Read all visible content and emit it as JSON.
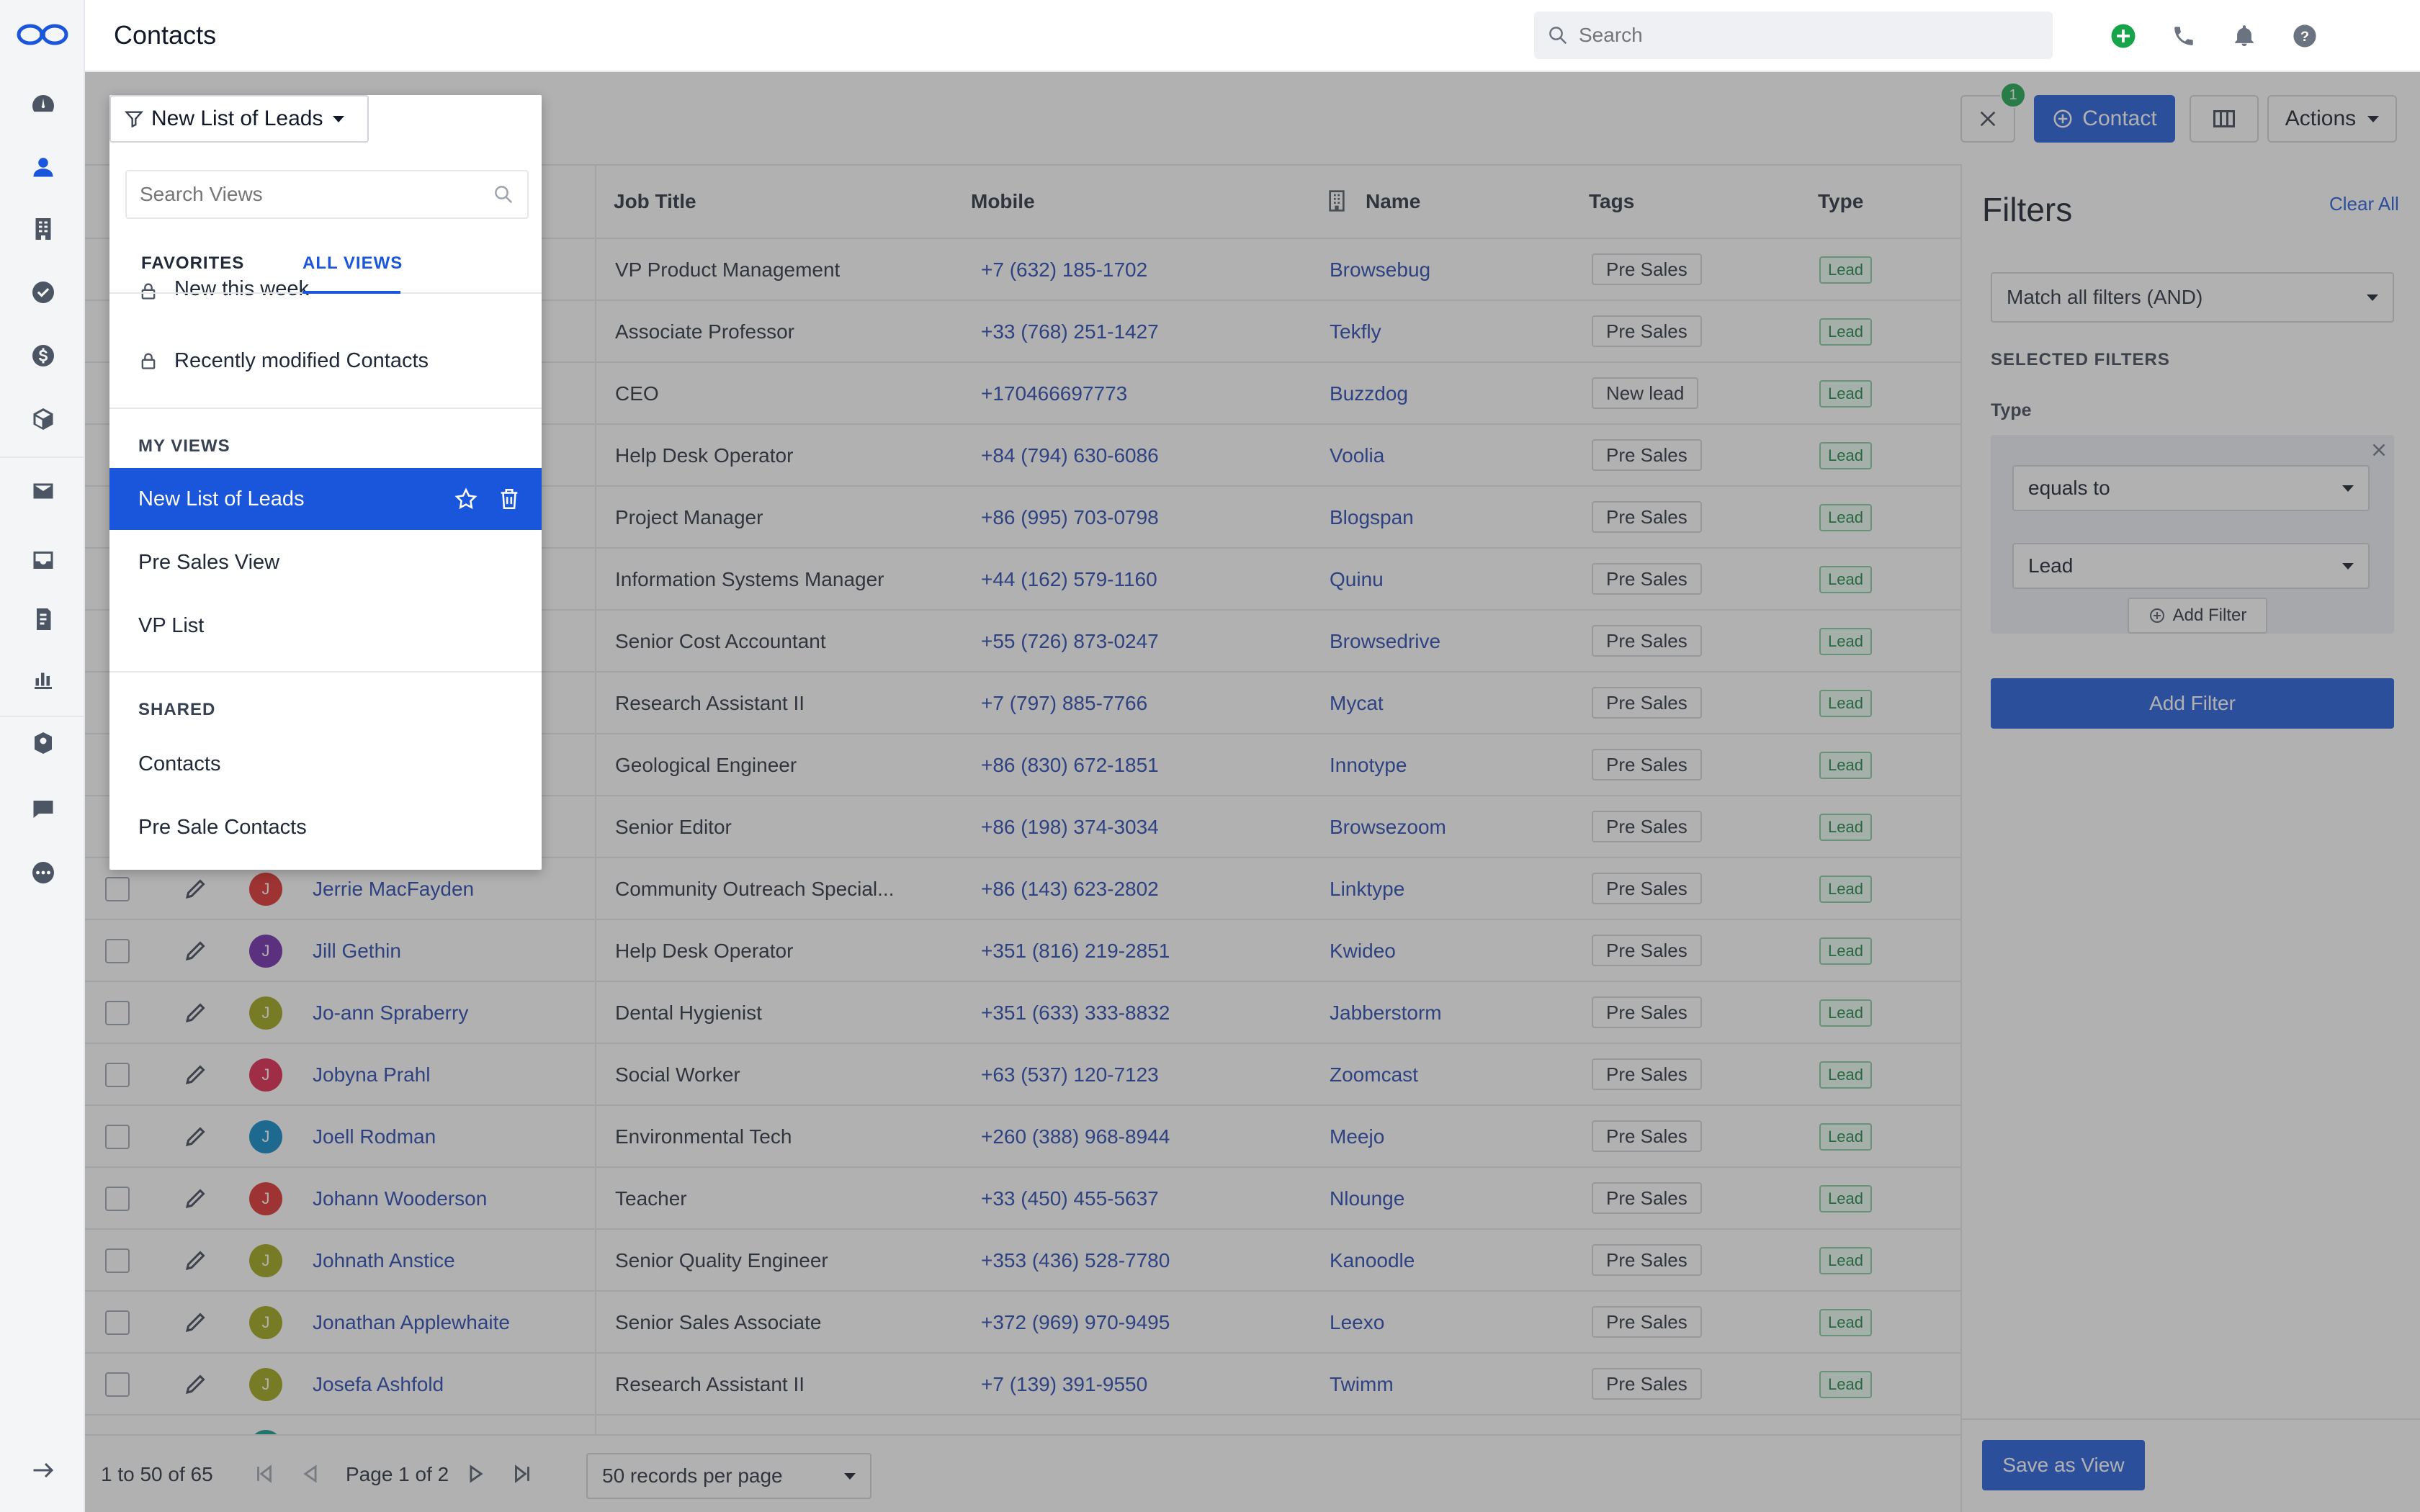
{
  "app": {
    "page_title": "Contacts"
  },
  "search": {
    "placeholder": "Search"
  },
  "toolbar": {
    "view_label": "New List of Leads",
    "filter_count": "1",
    "contact_label": "Contact",
    "actions_label": "Actions"
  },
  "table": {
    "headers": {
      "job_title": "Job Title",
      "mobile": "Mobile",
      "name": "Name",
      "tags": "Tags",
      "type": "Type"
    },
    "rows": [
      {
        "contact": "",
        "initial": "",
        "color": "",
        "job": "VP Product Management",
        "mobile": "+7 (632) 185-1702",
        "company": "Browsebug",
        "tag": "Pre Sales",
        "type": "Lead"
      },
      {
        "contact": "",
        "initial": "",
        "color": "",
        "job": "Associate Professor",
        "mobile": "+33 (768) 251-1427",
        "company": "Tekfly",
        "tag": "Pre Sales",
        "type": "Lead"
      },
      {
        "contact": "",
        "initial": "",
        "color": "",
        "job": "CEO",
        "mobile": "+170466697773",
        "company": "Buzzdog",
        "tag": "New lead",
        "type": "Lead"
      },
      {
        "contact": "",
        "initial": "",
        "color": "",
        "job": "Help Desk Operator",
        "mobile": "+84 (794) 630-6086",
        "company": "Voolia",
        "tag": "Pre Sales",
        "type": "Lead"
      },
      {
        "contact": "",
        "initial": "",
        "color": "",
        "job": "Project Manager",
        "mobile": "+86 (995) 703-0798",
        "company": "Blogspan",
        "tag": "Pre Sales",
        "type": "Lead"
      },
      {
        "contact": "",
        "initial": "",
        "color": "",
        "job": "Information Systems Manager",
        "mobile": "+44 (162) 579-1160",
        "company": "Quinu",
        "tag": "Pre Sales",
        "type": "Lead"
      },
      {
        "contact": "",
        "initial": "",
        "color": "",
        "job": "Senior Cost Accountant",
        "mobile": "+55 (726) 873-0247",
        "company": "Browsedrive",
        "tag": "Pre Sales",
        "type": "Lead"
      },
      {
        "contact": "",
        "initial": "",
        "color": "",
        "job": "Research Assistant II",
        "mobile": "+7 (797) 885-7766",
        "company": "Mycat",
        "tag": "Pre Sales",
        "type": "Lead"
      },
      {
        "contact": "",
        "initial": "",
        "color": "",
        "job": "Geological Engineer",
        "mobile": "+86 (830) 672-1851",
        "company": "Innotype",
        "tag": "Pre Sales",
        "type": "Lead"
      },
      {
        "contact": "",
        "initial": "",
        "color": "",
        "job": "Senior Editor",
        "mobile": "+86 (198) 374-3034",
        "company": "Browsezoom",
        "tag": "Pre Sales",
        "type": "Lead"
      },
      {
        "contact": "Jerrie MacFayden",
        "initial": "J",
        "color": "#dc2626",
        "job": "Community Outreach Special...",
        "mobile": "+86 (143) 623-2802",
        "company": "Linktype",
        "tag": "Pre Sales",
        "type": "Lead"
      },
      {
        "contact": "Jill Gethin",
        "initial": "J",
        "color": "#6b21a8",
        "job": "Help Desk Operator",
        "mobile": "+351 (816) 219-2851",
        "company": "Kwideo",
        "tag": "Pre Sales",
        "type": "Lead"
      },
      {
        "contact": "Jo-ann Spraberry",
        "initial": "J",
        "color": "#9ca30f",
        "job": "Dental Hygienist",
        "mobile": "+351 (633) 333-8832",
        "company": "Jabberstorm",
        "tag": "Pre Sales",
        "type": "Lead"
      },
      {
        "contact": "Jobyna Prahl",
        "initial": "J",
        "color": "#e11d48",
        "job": "Social Worker",
        "mobile": "+63 (537) 120-7123",
        "company": "Zoomcast",
        "tag": "Pre Sales",
        "type": "Lead"
      },
      {
        "contact": "Joell Rodman",
        "initial": "J",
        "color": "#0284c7",
        "job": "Environmental Tech",
        "mobile": "+260 (388) 968-8944",
        "company": "Meejo",
        "tag": "Pre Sales",
        "type": "Lead"
      },
      {
        "contact": "Johann Wooderson",
        "initial": "J",
        "color": "#dc2626",
        "job": "Teacher",
        "mobile": "+33 (450) 455-5637",
        "company": "Nlounge",
        "tag": "Pre Sales",
        "type": "Lead"
      },
      {
        "contact": "Johnath Anstice",
        "initial": "J",
        "color": "#9ca30f",
        "job": "Senior Quality Engineer",
        "mobile": "+353 (436) 528-7780",
        "company": "Kanoodle",
        "tag": "Pre Sales",
        "type": "Lead"
      },
      {
        "contact": "Jonathan Applewhaite",
        "initial": "J",
        "color": "#9ca30f",
        "job": "Senior Sales Associate",
        "mobile": "+372 (969) 970-9495",
        "company": "Leexo",
        "tag": "Pre Sales",
        "type": "Lead"
      },
      {
        "contact": "Josefa Ashfold",
        "initial": "J",
        "color": "#9ca30f",
        "job": "Research Assistant II",
        "mobile": "+7 (139) 391-9550",
        "company": "Twimm",
        "tag": "Pre Sales",
        "type": "Lead"
      }
    ]
  },
  "dropdown": {
    "search_placeholder": "Search Views",
    "tab_favorites": "FAVORITES",
    "tab_all_views": "ALL VIEWS",
    "system_items": [
      "New this week",
      "Recently modified Contacts"
    ],
    "my_views_heading": "MY VIEWS",
    "my_views": [
      "New List of Leads",
      "Pre Sales View",
      "VP List"
    ],
    "shared_heading": "SHARED",
    "shared": [
      "Contacts",
      "Pre Sale Contacts"
    ]
  },
  "filters": {
    "title": "Filters",
    "clear_all": "Clear All",
    "match": "Match all filters (AND)",
    "selected_heading": "SELECTED FILTERS",
    "field_label": "Type",
    "operator": "equals to",
    "value": "Lead",
    "inner_add": "Add Filter",
    "add_filter": "Add Filter",
    "save_view": "Save as View"
  },
  "pager": {
    "range": "1 to 50 of 65",
    "page": "Page 1 of 2",
    "per_page": "50 records per page"
  },
  "colors": {
    "accent": "#1a56db",
    "lead_green": "#15803d"
  }
}
